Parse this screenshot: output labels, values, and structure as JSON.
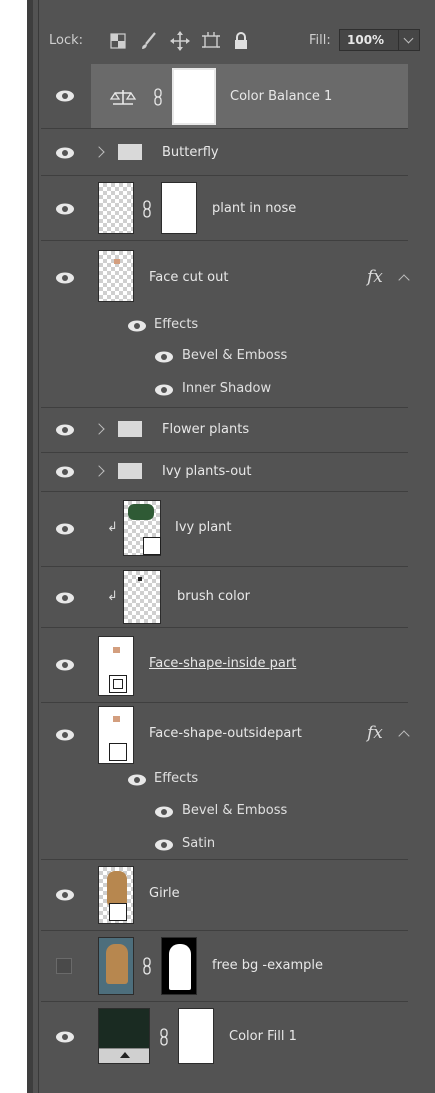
{
  "panel": {
    "lock_label": "Lock:",
    "fill_label": "Fill:",
    "fill_value": "100%",
    "colors": {
      "panel": "#535353",
      "selected_row": "#6a6a6a",
      "text": "#e8e8e8"
    }
  },
  "layers": [
    {
      "name": "Color Balance 1",
      "kind": "adjustment",
      "visible": true,
      "selected": true,
      "icon": "balance-scale-icon"
    },
    {
      "name": "Butterfly",
      "kind": "group",
      "visible": true,
      "collapsed": true
    },
    {
      "name": "plant in nose",
      "kind": "pixel-with-mask",
      "visible": true
    },
    {
      "name": "Face cut out",
      "kind": "pixel",
      "visible": true,
      "has_fx": true,
      "effects_label": "Effects",
      "effects": [
        "Bevel & Emboss",
        "Inner Shadow"
      ]
    },
    {
      "name": "Flower plants",
      "kind": "group",
      "visible": true,
      "collapsed": true
    },
    {
      "name": "Ivy plants-out",
      "kind": "group",
      "visible": true,
      "collapsed": true
    },
    {
      "name": "Ivy plant",
      "kind": "smart-object",
      "visible": true,
      "clipped": true
    },
    {
      "name": "brush color",
      "kind": "pixel",
      "visible": true,
      "clipped": true
    },
    {
      "name": "Face-shape-inside part",
      "kind": "shape",
      "visible": true
    },
    {
      "name": "Face-shape-outsidepart",
      "kind": "smart-object",
      "visible": true,
      "has_fx": true,
      "effects_label": "Effects",
      "effects": [
        "Bevel & Emboss",
        "Satin"
      ]
    },
    {
      "name": "Girle",
      "kind": "smart-object",
      "visible": true
    },
    {
      "name": "free bg -example",
      "kind": "pixel-with-mask",
      "visible": false
    },
    {
      "name": "Color Fill 1",
      "kind": "fill-with-mask",
      "visible": true
    }
  ]
}
